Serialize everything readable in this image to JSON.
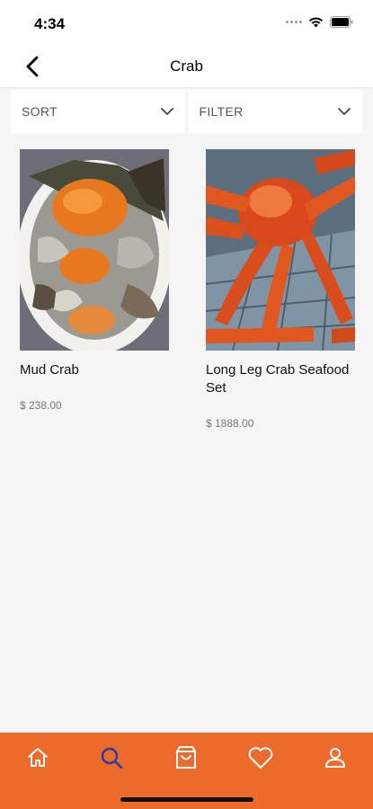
{
  "status_bar": {
    "time": "4:34"
  },
  "header": {
    "title": "Crab",
    "back_icon": "chevron-left-icon"
  },
  "controls": {
    "sort_label": "SORT",
    "filter_label": "FILTER"
  },
  "products": [
    {
      "name": "Mud Crab",
      "price": "$ 238.00",
      "image": "mud-crab-photo"
    },
    {
      "name": "Long Leg Crab Seafood Set",
      "price": "$ 1888.00",
      "image": "king-crab-photo"
    }
  ],
  "bottom_nav": {
    "items": [
      {
        "icon": "home-icon",
        "active": false
      },
      {
        "icon": "search-icon",
        "active": true
      },
      {
        "icon": "shopping-bag-icon",
        "active": false
      },
      {
        "icon": "heart-icon",
        "active": false
      },
      {
        "icon": "user-icon",
        "active": false
      }
    ]
  },
  "colors": {
    "accent": "#ec6a2c",
    "active_icon": "#2b3aa8",
    "inactive_icon": "#ffffff"
  }
}
